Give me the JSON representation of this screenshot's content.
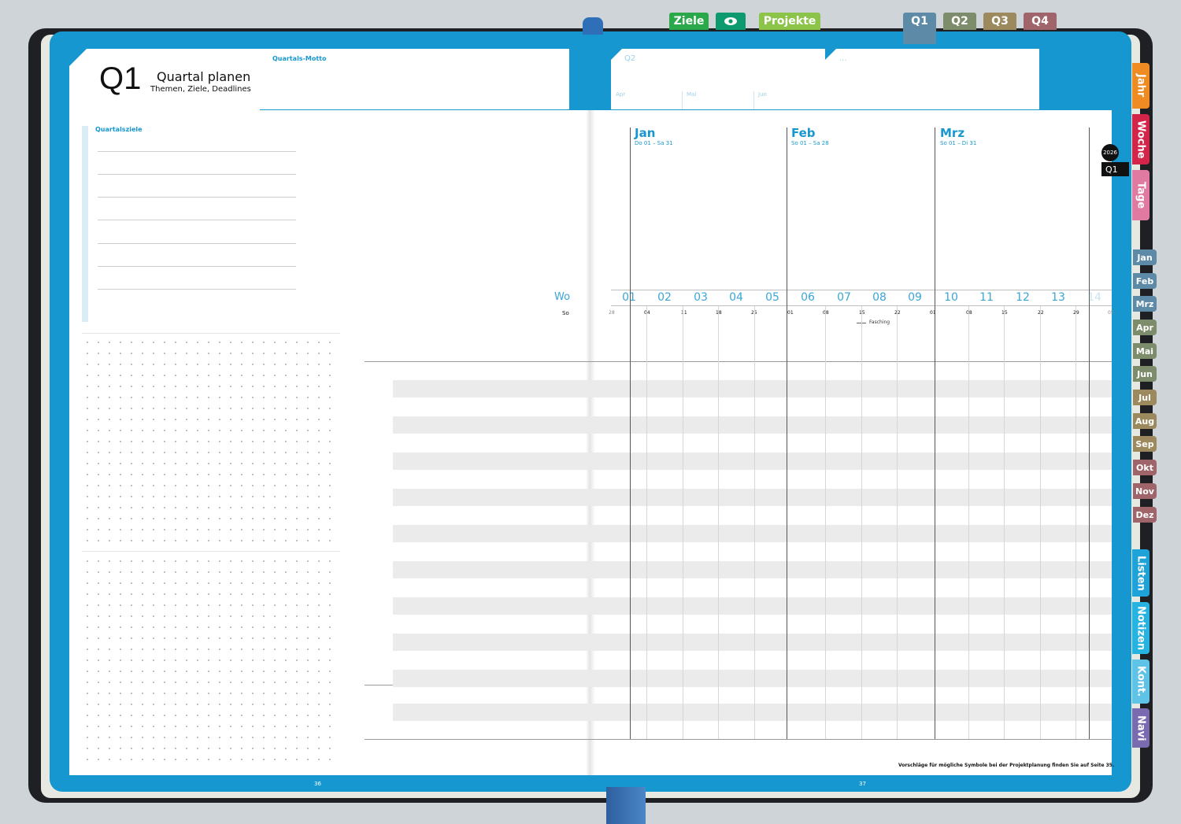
{
  "top_tabs": {
    "ziele": "Ziele",
    "projekte": "Projekte",
    "quarters": [
      "Q1",
      "Q2",
      "Q3",
      "Q4"
    ]
  },
  "side_tabs": {
    "jahr": "Jahr",
    "woche": "Woche",
    "tage": "Tage",
    "months": [
      "Jan",
      "Feb",
      "Mrz",
      "Apr",
      "Mai",
      "Jun",
      "Jul",
      "Aug",
      "Sep",
      "Okt",
      "Nov",
      "Dez"
    ],
    "listen": "Listen",
    "notizen": "Notizen",
    "kont": "Kont.",
    "navi": "Navi"
  },
  "header": {
    "quarter": "Q1",
    "title": "Quartal planen",
    "subtitle": "Themen, Ziele, Deadlines",
    "motto_label": "Quartals-Motto",
    "q2_label": "Q2",
    "q2_months": [
      "Apr",
      "Mai",
      "Jun"
    ],
    "more_label": "..."
  },
  "left": {
    "goals_label": "Quartalsziele"
  },
  "timeline": {
    "months": [
      {
        "name": "Jan",
        "range": "Do 01 – Sa 31"
      },
      {
        "name": "Feb",
        "range": "So 01 – Sa 28"
      },
      {
        "name": "Mrz",
        "range": "So 01 – Di 31"
      }
    ],
    "year_badge": "2026",
    "quarter_badge": "Q1",
    "week_label": "Wo",
    "weeks": [
      "01",
      "02",
      "03",
      "04",
      "05",
      "06",
      "07",
      "08",
      "09",
      "10",
      "11",
      "12",
      "13",
      "14"
    ],
    "day_label": "So",
    "dates": [
      "28",
      "04",
      "11",
      "18",
      "25",
      "01",
      "08",
      "15",
      "22",
      "01",
      "08",
      "15",
      "22",
      "29",
      "05"
    ],
    "event": "Fasching"
  },
  "footer": {
    "note": "Vorschläge für mögliche Symbole bei der Projektplanung finden Sie auf Seite 35.",
    "page_left": "36",
    "page_right": "37"
  },
  "colors": {
    "frame": "#1797cf",
    "ziele": "#2aa84a",
    "eye": "#0d9a6e",
    "projekte": "#8cc44a",
    "q1": "#5d8aa6",
    "q2": "#7d8c6a",
    "q3": "#9c8a5e",
    "q4": "#a0656a"
  }
}
